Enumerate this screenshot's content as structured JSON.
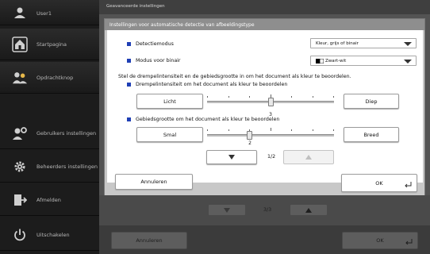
{
  "sidebar": {
    "user": {
      "label": "User1",
      "icon": "user-icon"
    },
    "items": [
      {
        "label": "Startpagina",
        "icon": "home-icon"
      },
      {
        "label": "Opdrachtknop",
        "icon": "users-icon"
      },
      {
        "label": "Gebruikers instellingen",
        "icon": "user-settings-icon"
      },
      {
        "label": "Beheerders instellingen",
        "icon": "gear-icon"
      },
      {
        "label": "Afmelden",
        "icon": "logout-icon"
      },
      {
        "label": "Uitschakelen",
        "icon": "power-icon"
      }
    ]
  },
  "main": {
    "title": "Geavanceerde instellingen",
    "pager": {
      "text": "3/3"
    },
    "cancel_label": "Annuleren",
    "ok_label": "OK"
  },
  "dialog": {
    "title": "Instellingen voor automatische detectie van afbeeldingstype",
    "detect_mode": {
      "label": "Detectiemodus",
      "value": "Kleur, grijs of binair"
    },
    "binary_mode": {
      "label": "Modus voor binair",
      "value": "Zwart-wit"
    },
    "description": "Stel de drempelintensiteit en de gebiedsgrootte in om het document als kleur te beoordelen.",
    "threshold": {
      "label": "Drempelintensiteit om het document als kleur te beoordelen",
      "left_label": "Licht",
      "right_label": "Diep",
      "value": "3",
      "level": 3,
      "min": 0,
      "max": 6
    },
    "area": {
      "label": "Gebiedsgrootte om het document als kleur te beoordelen",
      "left_label": "Smal",
      "right_label": "Breed",
      "value": "2",
      "level": 2,
      "min": 0,
      "max": 6
    },
    "pager": {
      "text": "1/2"
    },
    "cancel_label": "Annuleren",
    "ok_label": "OK"
  },
  "colors": {
    "accent": "#1f3fb5",
    "sidebar": "#1c1c1c",
    "dialog_frame": "#c8c8c8",
    "overlay": "#535353"
  }
}
